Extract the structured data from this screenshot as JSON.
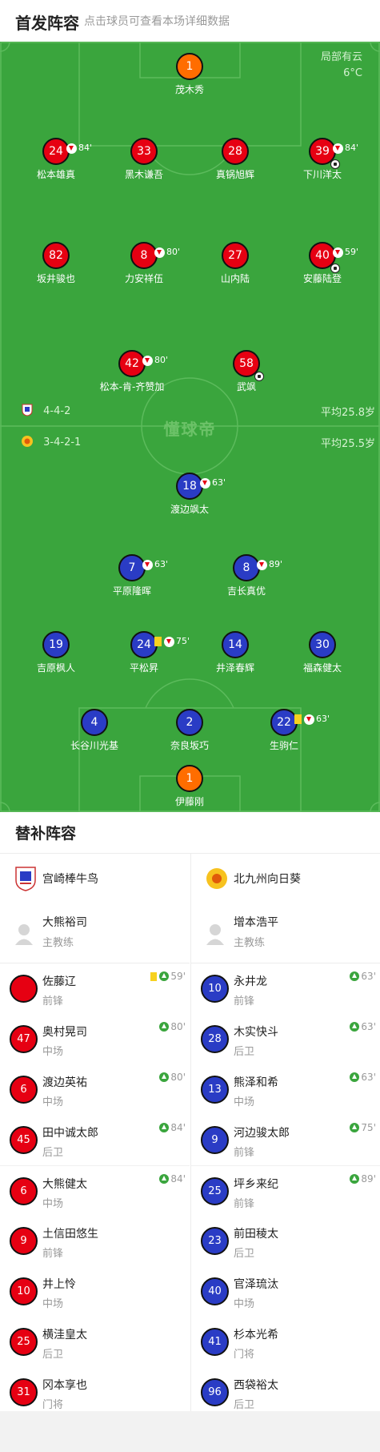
{
  "header": {
    "title": "首发阵容",
    "subtitle": "点击球员可查看本场详细数据"
  },
  "weather": {
    "condition": "局部有云",
    "temperature": "6°C"
  },
  "watermark": "懂球帝",
  "home_formation": {
    "formation": "4-4-2",
    "avg_age": "平均25.8岁"
  },
  "away_formation": {
    "formation": "3-4-2-1",
    "avg_age": "平均25.5岁"
  },
  "home_lineup": [
    {
      "number": "1",
      "name": "茂木秀",
      "color": "orange"
    },
    {
      "number": "24",
      "name": "松本雄真",
      "sub_out": "84'"
    },
    {
      "number": "33",
      "name": "黑木谦吾"
    },
    {
      "number": "28",
      "name": "真锅旭辉"
    },
    {
      "number": "39",
      "name": "下川洋太",
      "sub_out": "84'",
      "goal": true
    },
    {
      "number": "82",
      "name": "坂井骏也"
    },
    {
      "number": "8",
      "name": "力安祥伍",
      "sub_out": "80'"
    },
    {
      "number": "27",
      "name": "山内陆"
    },
    {
      "number": "40",
      "name": "安藤陆登",
      "sub_out": "59'",
      "goal": true
    },
    {
      "number": "42",
      "name": "松本-肯-齐赞加",
      "sub_out": "80'"
    },
    {
      "number": "58",
      "name": "武飒",
      "goal": true
    }
  ],
  "away_lineup": [
    {
      "number": "18",
      "name": "渡边飒太",
      "sub_out": "63'"
    },
    {
      "number": "7",
      "name": "平原隆晖",
      "sub_out": "63'"
    },
    {
      "number": "8",
      "name": "吉长真优",
      "sub_out": "89'"
    },
    {
      "number": "19",
      "name": "吉原枫人"
    },
    {
      "number": "24",
      "name": "平松昇",
      "sub_out": "75'",
      "yellow": true
    },
    {
      "number": "14",
      "name": "井泽春辉"
    },
    {
      "number": "30",
      "name": "福森健太"
    },
    {
      "number": "4",
      "name": "长谷川光基"
    },
    {
      "number": "2",
      "name": "奈良坂巧"
    },
    {
      "number": "22",
      "name": "生驹仁",
      "sub_out": "63'",
      "yellow": true
    },
    {
      "number": "1",
      "name": "伊藤刚",
      "color": "orange"
    }
  ],
  "subs_section": {
    "title": "替补阵容",
    "home": {
      "team": "宫崎棒牛鸟",
      "coach": {
        "name": "大熊裕司",
        "role": "主教练"
      },
      "players": [
        {
          "number": "",
          "name": "佐藤辽",
          "position": "前锋",
          "sub_in": "59'",
          "yellow": true
        },
        {
          "number": "47",
          "name": "奥村晃司",
          "position": "中场",
          "sub_in": "80'"
        },
        {
          "number": "6",
          "name": "渡边英祐",
          "position": "中场",
          "sub_in": "80'"
        },
        {
          "number": "45",
          "name": "田中诚太郎",
          "position": "后卫",
          "sub_in": "84'"
        },
        {
          "number": "6",
          "name": "大熊健太",
          "position": "中场",
          "sub_in": "84'"
        },
        {
          "number": "9",
          "name": "土信田悠生",
          "position": "前锋"
        },
        {
          "number": "10",
          "name": "井上怜",
          "position": "中场"
        },
        {
          "number": "25",
          "name": "横洼皇太",
          "position": "后卫"
        },
        {
          "number": "31",
          "name": "冈本享也",
          "position": "门将"
        }
      ]
    },
    "away": {
      "team": "北九州向日葵",
      "coach": {
        "name": "增本浩平",
        "role": "主教练"
      },
      "players": [
        {
          "number": "10",
          "name": "永井龙",
          "position": "前锋",
          "sub_in": "63'"
        },
        {
          "number": "28",
          "name": "木实快斗",
          "position": "后卫",
          "sub_in": "63'"
        },
        {
          "number": "13",
          "name": "熊泽和希",
          "position": "中场",
          "sub_in": "63'"
        },
        {
          "number": "9",
          "name": "河边骏太郎",
          "position": "前锋",
          "sub_in": "75'"
        },
        {
          "number": "25",
          "name": "坪乡来纪",
          "position": "前锋",
          "sub_in": "89'"
        },
        {
          "number": "23",
          "name": "前田稜太",
          "position": "后卫"
        },
        {
          "number": "40",
          "name": "官泽琉汰",
          "position": "中场"
        },
        {
          "number": "41",
          "name": "杉本光希",
          "position": "门将"
        },
        {
          "number": "96",
          "name": "西袋裕太",
          "position": "后卫"
        }
      ]
    }
  },
  "colors": {
    "pitch": "#3aa53d",
    "home": "#e60012",
    "away": "#2a3cc5",
    "keeper": "#ff6d00"
  }
}
